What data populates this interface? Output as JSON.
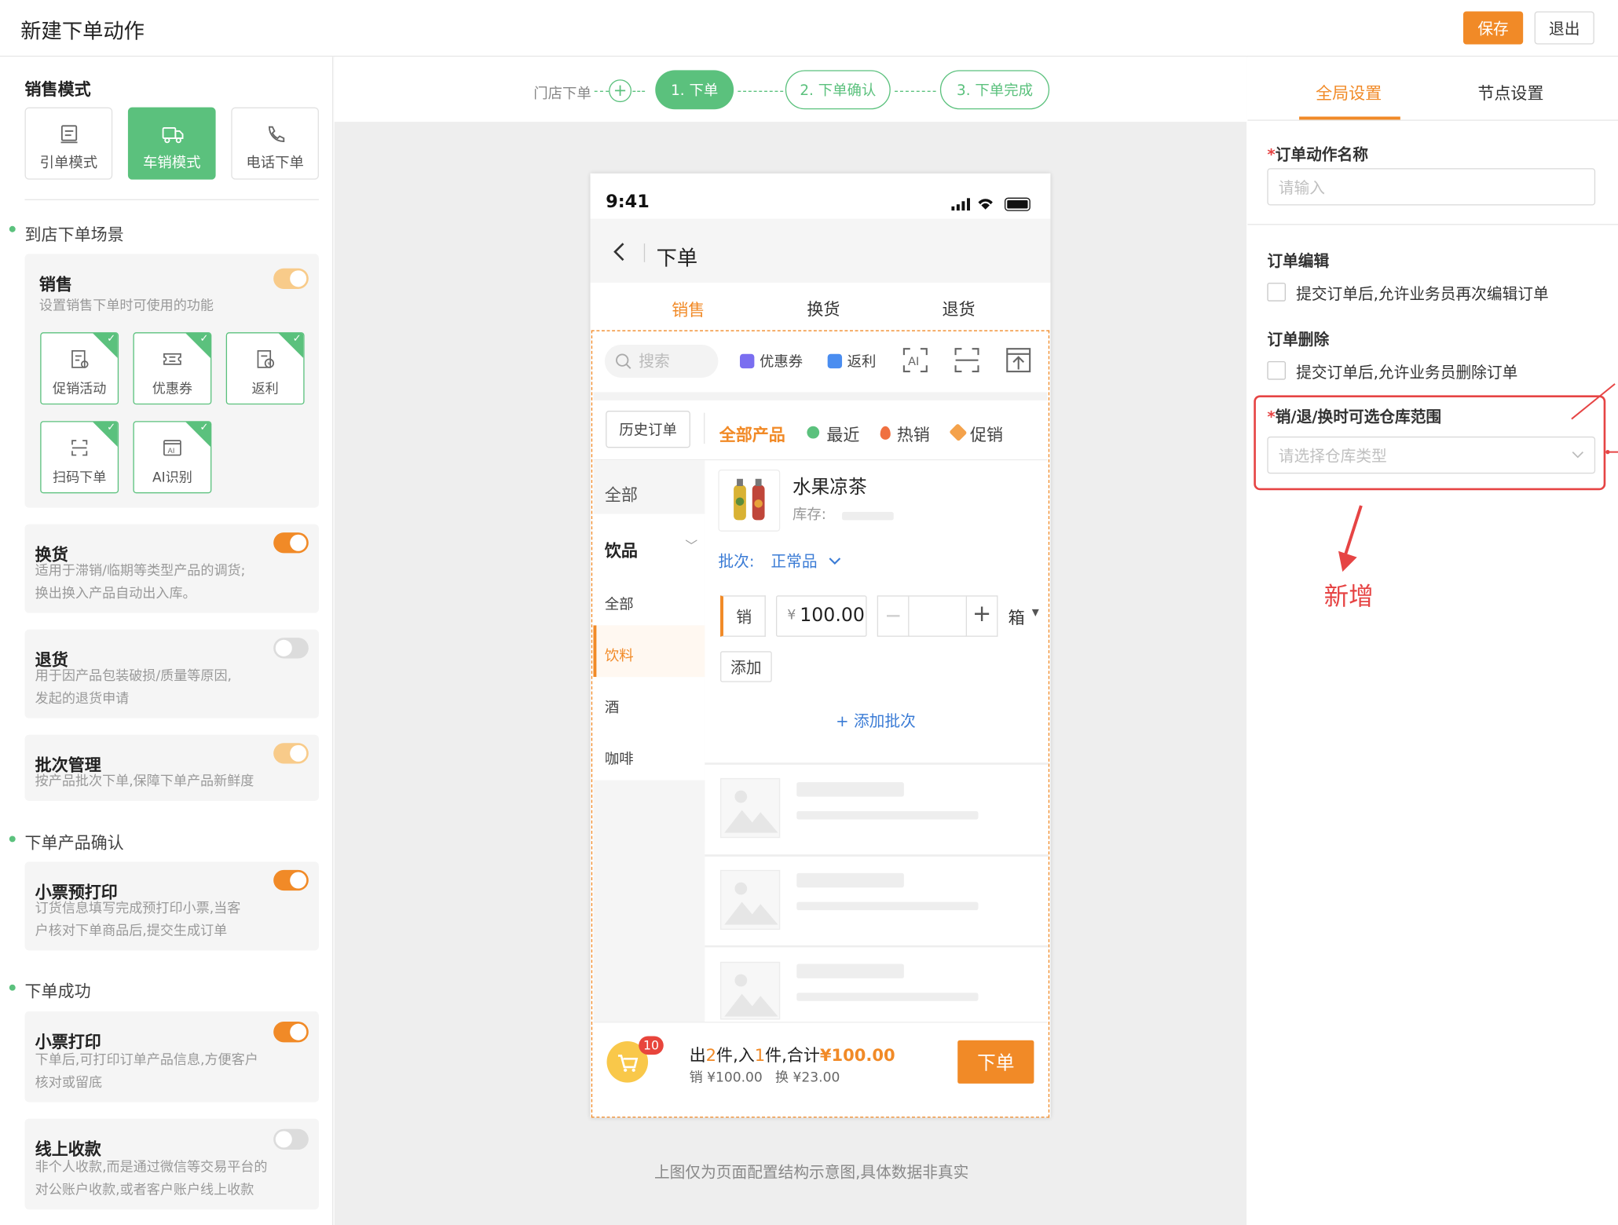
{
  "header": {
    "title": "新建下单动作",
    "save_label": "保存",
    "exit_label": "退出"
  },
  "left": {
    "sales_mode_title": "销售模式",
    "modes": [
      {
        "label": "引单模式",
        "icon": "receipt-icon",
        "active": false
      },
      {
        "label": "车销模式",
        "icon": "truck-icon",
        "active": true
      },
      {
        "label": "电话下单",
        "icon": "phone-icon",
        "active": false
      }
    ],
    "scene1": "到店下单场景",
    "sales_card": {
      "title": "销售",
      "desc": "设置销售下单时可使用的功能",
      "toggle": "disabled-on",
      "features": [
        {
          "label": "促销活动",
          "icon": "promotion-icon"
        },
        {
          "label": "优惠券",
          "icon": "coupon-icon"
        },
        {
          "label": "返利",
          "icon": "rebate-icon"
        },
        {
          "label": "扫码下单",
          "icon": "scan-icon"
        },
        {
          "label": "AI识别",
          "icon": "ai-icon"
        }
      ]
    },
    "exchange_card": {
      "title": "换货",
      "desc1": "适用于滞销/临期等类型产品的调货;",
      "desc2": "换出换入产品自动出入库。",
      "toggle": "on"
    },
    "return_card": {
      "title": "退货",
      "desc1": "用于因产品包装破损/质量等原因,",
      "desc2": "发起的退货申请",
      "toggle": "off"
    },
    "batch_card": {
      "title": "批次管理",
      "desc": "按产品批次下单,保障下单产品新鲜度",
      "toggle": "disabled-on"
    },
    "scene2": "下单产品确认",
    "preprint_card": {
      "title": "小票预打印",
      "desc1": "订货信息填写完成预打印小票,当客",
      "desc2": "户核对下单商品后,提交生成订单",
      "toggle": "on"
    },
    "scene3": "下单成功",
    "print_card": {
      "title": "小票打印",
      "desc1": "下单后,可打印订单产品信息,方便客户",
      "desc2": "核对或留底",
      "toggle": "on"
    },
    "online_card": {
      "title": "线上收款",
      "desc1": "非个人收款,而是通过微信等交易平台的",
      "desc2": "对公账户收款,或者客户账户线上收款",
      "toggle": "off"
    }
  },
  "steps": {
    "pre": "门店下单",
    "s1": "1. 下单",
    "s2": "2. 下单确认",
    "s3": "3. 下单完成"
  },
  "phone": {
    "time": "9:41",
    "title": "下单",
    "tabs": [
      "销售",
      "换货",
      "退货"
    ],
    "search_placeholder": "搜索",
    "coupon": "优惠券",
    "rebate": "返利",
    "history": "历史订单",
    "filters": {
      "all": "全部产品",
      "recent": "最近",
      "hot": "热销",
      "promo": "促销"
    },
    "cats": {
      "all": "全部",
      "drink": "饮品",
      "sub_all": "全部",
      "beverage": "饮料",
      "wine": "酒",
      "coffee": "咖啡"
    },
    "product": {
      "name": "水果凉茶",
      "stock_label": "库存:",
      "batch_label": "批次:",
      "batch_value": "正常品",
      "sale_tag": "销",
      "price": "100.00",
      "currency": "¥",
      "unit": "箱",
      "add": "添加",
      "add_batch": "+ 添加批次"
    },
    "footer": {
      "badge": "10",
      "out_pre": "出",
      "out_n": "2",
      "mid": "件,入",
      "in_n": "1",
      "tot_pre": "件,合计",
      "total": "¥100.00",
      "line2": "销 ¥100.00   换 ¥23.00",
      "order_btn": "下单"
    }
  },
  "note": "上图仅为页面配置结构示意图,具体数据非真实",
  "right": {
    "tab_global": "全局设置",
    "tab_node": "节点设置",
    "name_label": "订单动作名称",
    "name_placeholder": "请输入",
    "edit_label": "订单编辑",
    "edit_cb": "提交订单后,允许业务员再次编辑订单",
    "del_label": "订单删除",
    "del_cb": "提交订单后,允许业务员删除订单",
    "wh_label": "销/退/换时可选仓库范围",
    "wh_placeholder": "请选择仓库类型",
    "annotation": "新增"
  },
  "colors": {
    "accent": "#f18a27",
    "green": "#5bc17d",
    "annotation": "#e64444"
  }
}
